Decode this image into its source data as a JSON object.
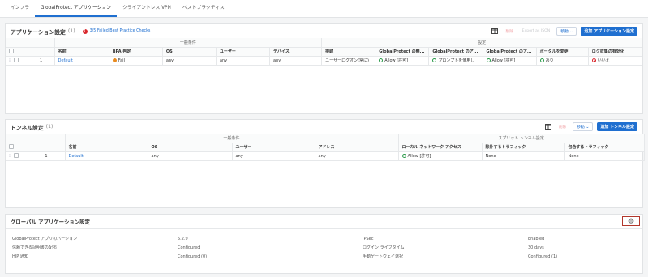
{
  "tabs": [
    {
      "label": "インフラ",
      "active": false
    },
    {
      "label": "GlobalProtect アプリケーション",
      "active": true
    },
    {
      "label": "クライアントレス VPN",
      "active": false
    },
    {
      "label": "ベストプラクティス",
      "active": false
    }
  ],
  "app_settings": {
    "title": "アプリケーション設定",
    "count": "(1)",
    "warning_num": "!",
    "warning_text": "3/5 Failed Best Practice Checks",
    "delete_label": "削除",
    "export_label": "Export as JSON",
    "move_label": "移動",
    "add_label": "追加 アプリケーション設定",
    "group_general": "一般条件",
    "group_settings": "設定",
    "columns": [
      "名前",
      "BPA 判定",
      "OS",
      "ユーザー",
      "デバイス",
      "接続",
      "GlobalProtect の無...",
      "GlobalProtect のア...",
      "GlobalProtect のア...",
      "ポータルを変更",
      "ログ収集の有効化"
    ],
    "rows": [
      {
        "num": "1",
        "name": "Default",
        "bpa": "Fail",
        "os": "any",
        "user": "any",
        "device": "any",
        "connect": "ユーザーログオン(常に)",
        "c1": "Allow [許可]",
        "c2": "プロンプトを使用し",
        "c3": "Allow [許可]",
        "portal": "あり",
        "log": "いいえ"
      }
    ]
  },
  "tunnel_settings": {
    "title": "トンネル設定",
    "count": "(1)",
    "delete_label": "削除",
    "move_label": "移動",
    "add_label": "追加 トンネル設定",
    "group_general": "一般条件",
    "group_split": "スプリット トンネル設定",
    "columns": [
      "名前",
      "OS",
      "ユーザー",
      "アドレス",
      "ローカル ネットワーク アクセス",
      "除外するトラフィック",
      "包含するトラフィック"
    ],
    "rows": [
      {
        "num": "1",
        "name": "Default",
        "os": "any",
        "user": "any",
        "address": "any",
        "local": "Allow [許可]",
        "exclude": "None",
        "include": "None"
      }
    ]
  },
  "global_settings": {
    "title": "グローバル アプリケーション設定",
    "rows": [
      {
        "label1": "GlobalProtect アプリのバージョン",
        "value1": "5.2.9",
        "label2": "IPSec",
        "value2": "Enabled"
      },
      {
        "label1": "信頼できる証明書の配布",
        "value1": "Configured",
        "label2": "ログイン ライフタイム",
        "value2": "30 days"
      },
      {
        "label1": "HIP 通知",
        "value1": "Configured (0)",
        "label2": "手動ゲートウェイ選択",
        "value2": "Configured (1)"
      }
    ]
  }
}
